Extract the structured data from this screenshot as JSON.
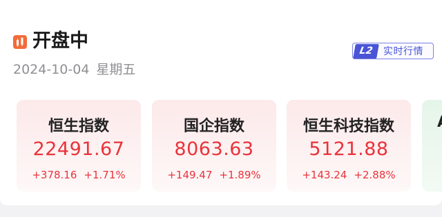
{
  "header": {
    "title": "开盘中",
    "date": "2024-10-04",
    "weekday": "星期五",
    "icon": "candlestick-icon",
    "badge": {
      "mark": "L2",
      "label": "实时行情"
    }
  },
  "indices": [
    {
      "name": "恒生指数",
      "value": "22491.67",
      "change": "+378.16",
      "change_pct": "+1.71%"
    },
    {
      "name": "国企指数",
      "value": "8063.63",
      "change": "+149.47",
      "change_pct": "+1.89%"
    },
    {
      "name": "恒生科技指数",
      "value": "5121.88",
      "change": "+143.24",
      "change_pct": "+2.88%"
    }
  ],
  "next_card": {
    "name_partial": "A"
  },
  "colors": {
    "up": "#e8333c",
    "accent": "#4a54d6",
    "icon": "#f26b3a"
  }
}
